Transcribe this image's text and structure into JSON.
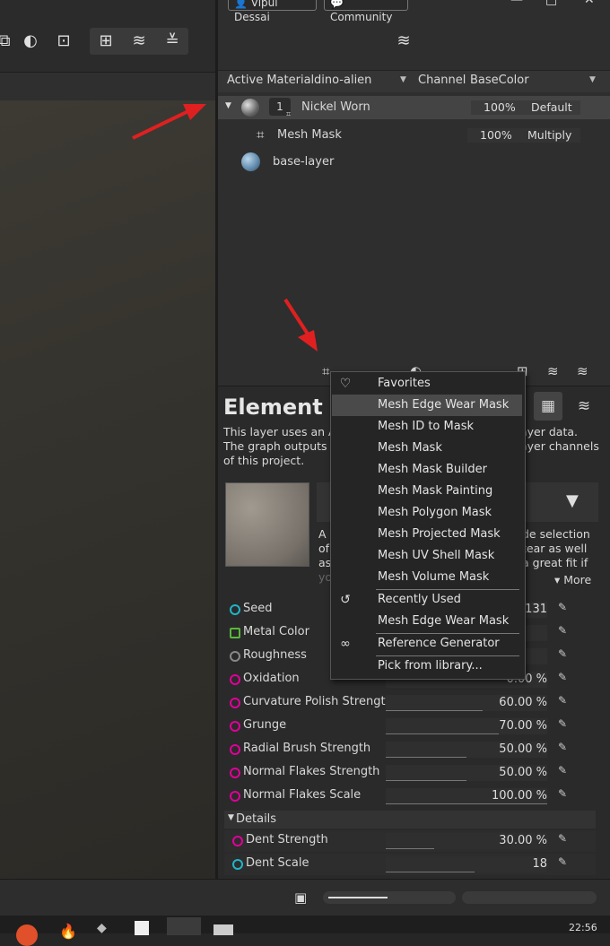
{
  "header": {
    "user_chip": "Vipul Dessai",
    "community_chip": "Community",
    "minimize_icon": "minimize-icon",
    "maximize_icon": "maximize-icon",
    "close_icon": "close-icon"
  },
  "material_bar": {
    "active_material_label": "Active Material",
    "active_material_value": "dino-alien",
    "channel_label": "Channel",
    "channel_value": "BaseColor"
  },
  "layers": [
    {
      "index": "1",
      "name": "Nickel Worn",
      "opacity": "100%",
      "blend": "Default"
    },
    {
      "name": "Mesh Mask",
      "opacity": "100%",
      "blend": "Multiply"
    },
    {
      "name": "base-layer"
    }
  ],
  "element_panel": {
    "title_visible": "Element La",
    "desc_line1_left": "This layer uses an At",
    "desc_line1_right": "ayer data.",
    "desc_line2_left": "The graph outputs ca",
    "desc_line2_right": "ayer channels",
    "desc_line3": "of this project.",
    "card_text_right1": "de selection",
    "card_text_right2": "tear as well",
    "card_text_right3": "a great fit if",
    "card_left1": "A",
    "card_left2": "of",
    "card_left3": "as",
    "card_left4": "yo",
    "more_label": "More"
  },
  "parameters": [
    {
      "name": "Seed",
      "value": "4131",
      "dot_color": "#1fb5c8"
    },
    {
      "name": "Metal Color",
      "value": "",
      "dot_color": "#58b83a"
    },
    {
      "name": "Roughness",
      "value": "",
      "dot_color": "#888888"
    },
    {
      "name": "Oxidation",
      "value": "0.00 %",
      "fill": 0.0
    },
    {
      "name": "Curvature Polish Strength",
      "value": "60.00 %",
      "fill": 0.6
    },
    {
      "name": "Grunge",
      "value": "70.00 %",
      "fill": 0.7
    },
    {
      "name": "Radial Brush Strength",
      "value": "50.00 %",
      "fill": 0.5
    },
    {
      "name": "Normal Flakes Strength",
      "value": "50.00 %",
      "fill": 0.5
    },
    {
      "name": "Normal Flakes Scale",
      "value": "100.00 %",
      "fill": 1.0
    }
  ],
  "details": {
    "label": "Details",
    "params": [
      {
        "name": "Dent Strength",
        "value": "30.00 %",
        "fill": 0.3
      },
      {
        "name": "Dent Scale",
        "value": "18",
        "fill": 0.55
      }
    ]
  },
  "context_menu": {
    "items": [
      {
        "label": "Favorites",
        "icon": "heart-icon"
      },
      {
        "label": "Mesh Edge Wear Mask",
        "selected": true
      },
      {
        "label": "Mesh ID to Mask"
      },
      {
        "label": "Mesh Mask"
      },
      {
        "label": "Mesh Mask Builder"
      },
      {
        "label": "Mesh Mask Painting"
      },
      {
        "label": "Mesh Polygon Mask"
      },
      {
        "label": "Mesh Projected Mask"
      },
      {
        "label": "Mesh UV Shell Mask"
      },
      {
        "label": "Mesh Volume Mask"
      },
      {
        "label": "Recently Used",
        "icon": "history-icon"
      },
      {
        "label": "Mesh Edge Wear Mask"
      },
      {
        "label": "Reference Generator",
        "icon": "link-icon"
      },
      {
        "label": "Pick from library..."
      }
    ]
  },
  "taskbar": {
    "clock": "22:56"
  },
  "colors": {
    "accent_magenta": "#e0009a",
    "arrow_red": "#e02020",
    "selected_item": "#4a4a4a"
  }
}
